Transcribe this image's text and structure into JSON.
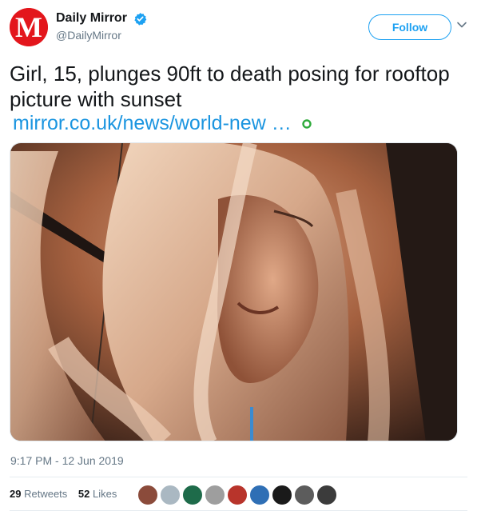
{
  "account": {
    "display_name": "Daily Mirror",
    "handle": "@DailyMirror",
    "logo_letter": "M",
    "brand_color": "#e3161c"
  },
  "actions": {
    "follow_label": "Follow"
  },
  "tweet": {
    "text": "Girl, 15, plunges 90ft to death posing for rooftop picture with sunset",
    "link": "mirror.co.uk/news/world-new …",
    "timestamp": "9:17 PM - 12 Jun 2019"
  },
  "stats": {
    "retweets_count": "29",
    "retweets_label": "Retweets",
    "likes_count": "52",
    "likes_label": "Likes"
  },
  "colors": {
    "link": "#1b95e0",
    "accent": "#1da1f2",
    "muted": "#657786"
  },
  "liker_avatars": [
    "#8b4b3b",
    "#aab8c2",
    "#1e6b4a",
    "#9e9e9e",
    "#b8342b",
    "#2f6fb5",
    "#1a1a1a",
    "#5c5c5c",
    "#3b3b3b"
  ]
}
